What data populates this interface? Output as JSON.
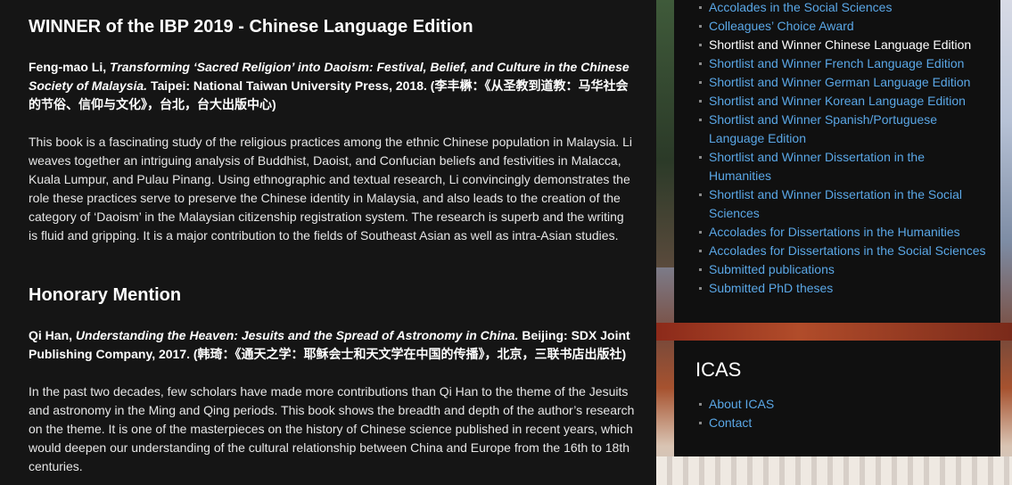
{
  "main": {
    "winner_heading": "WINNER of the IBP 2019 - Chinese Language Edition",
    "winner_citation": {
      "author": "Feng-mao Li, ",
      "title": "Transforming ‘Sacred Religion’ into Daoism: Festival, Belief, and Culture in the Chinese Society of Malaysia.",
      "publisher": " Taipei: National Taiwan University Press, 2018. (李丰楙：《从圣教到道教：马华社会的节俗、信仰与文化》，台北，台大出版中心)"
    },
    "winner_description": "This book is a fascinating study of the religious practices among the ethnic Chinese population in Malaysia. Li weaves together an intriguing analysis of Buddhist, Daoist, and Confucian beliefs and festivities in Malacca, Kuala Lumpur, and Pulau Pinang. Using ethnographic and textual research, Li convincingly demonstrates the role these practices serve to preserve the Chinese identity in Malaysia, and also leads to the creation of the category of ‘Daoism’ in the Malaysian citizenship registration system. The research is superb and the writing is fluid and gripping. It is a major contribution to the fields of Southeast Asian as well as intra-Asian studies.",
    "honorary_heading": "Honorary Mention",
    "honorary_citation": {
      "author": "Qi Han, ",
      "title": "Understanding the Heaven: Jesuits and the Spread of Astronomy in China.",
      "publisher": " Beijing: SDX Joint Publishing Company, 2017. (韩琦：《通天之学：耶稣会士和天文学在中国的传播》，北京，三联书店出版社)"
    },
    "honorary_description": "In the past two decades, few scholars have made more contributions than Qi Han to the theme of the Jesuits and astronomy in the Ming and Qing periods. This book shows the breadth and depth of the author’s research on the theme. It is one of the masterpieces on the history of Chinese science published in recent years, which would deepen our understanding of the cultural relationship between China and Europe from the 16th to 18th centuries."
  },
  "sidebar": {
    "links": [
      {
        "label": "Accolades in the Social Sciences",
        "current": false
      },
      {
        "label": "Colleagues’ Choice Award",
        "current": false
      },
      {
        "label": "Shortlist and Winner Chinese Language Edition",
        "current": true
      },
      {
        "label": "Shortlist and Winner French Language Edition",
        "current": false
      },
      {
        "label": "Shortlist and Winner German Language Edition",
        "current": false
      },
      {
        "label": "Shortlist and Winner Korean Language Edition",
        "current": false
      },
      {
        "label": "Shortlist and Winner Spanish/Portuguese Language Edition",
        "current": false
      },
      {
        "label": "Shortlist and Winner Dissertation in the Humanities",
        "current": false
      },
      {
        "label": "Shortlist and Winner Dissertation in the Social Sciences",
        "current": false
      },
      {
        "label": "Accolades for Dissertations in the Humanities",
        "current": false
      },
      {
        "label": "Accolades for Dissertations in the Social Sciences",
        "current": false
      },
      {
        "label": "Submitted publications",
        "current": false
      },
      {
        "label": "Submitted PhD theses",
        "current": false
      }
    ],
    "icas": {
      "title": "ICAS",
      "links": [
        {
          "label": "About ICAS"
        },
        {
          "label": "Contact"
        }
      ]
    }
  },
  "colors": {
    "link": "#5aa7e6",
    "background": "#151515",
    "box": "#101010"
  }
}
